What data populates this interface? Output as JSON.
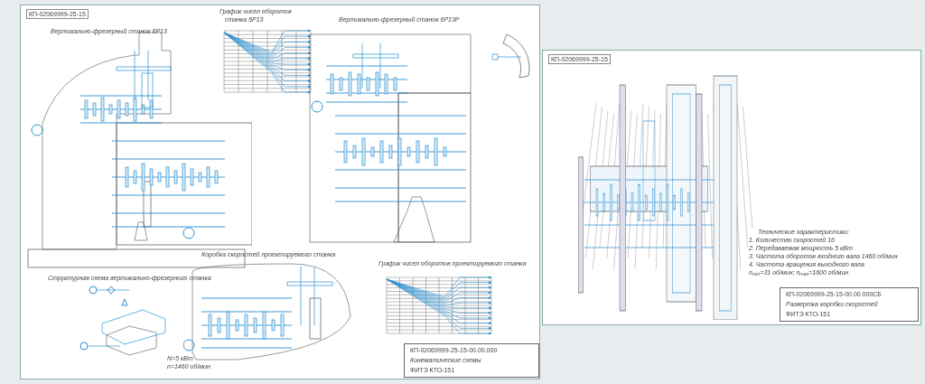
{
  "left_sheet": {
    "stamp_label": "КП-02069999-25-15",
    "machine_6r13": {
      "title": "Вертикально-фрезерный станок 6Р13"
    },
    "graph_6r13": {
      "title_lines": [
        "График чисел оборотов",
        "станка 6Р13"
      ]
    },
    "machine_6r13r": {
      "title": "Вертикально-фрезерный станок 6Р13Р"
    },
    "gearbox": {
      "title": "Коробка скоростей проектируемого станка"
    },
    "structure": {
      "title": "Структурная схема вертикально-фрезерного станка"
    },
    "motor_specs": [
      "N=5 кВт",
      "n=1460 об/мин"
    ],
    "graph_designed": {
      "title": "График чисел оборотов проектируемого станка"
    },
    "title_block": {
      "code": "КП-02069999-25-15-00.00.000",
      "name": "Кинематические схемы",
      "group": "ФИТЭ КТО-151"
    }
  },
  "right_sheet": {
    "stamp_label": "КП-02069999-25-15",
    "tech_specs": {
      "heading": "Технические характеристики:",
      "lines": [
        "1. Количество скоростей 16",
        "2. Передаваемая мощность 5 кВт",
        "3. Частота оборотов входного вала 1460 об/мин",
        "4. Частота вращения выходного вала",
        "n$_{min}$=31 об/мин; n$_{max}$=1600 об/мин"
      ]
    },
    "title_block": {
      "code": "КП-02069999-25-15-00.00.000СБ",
      "name": "Развертка коробки скоростей",
      "group": "ФИТЭ КТО-151"
    }
  }
}
